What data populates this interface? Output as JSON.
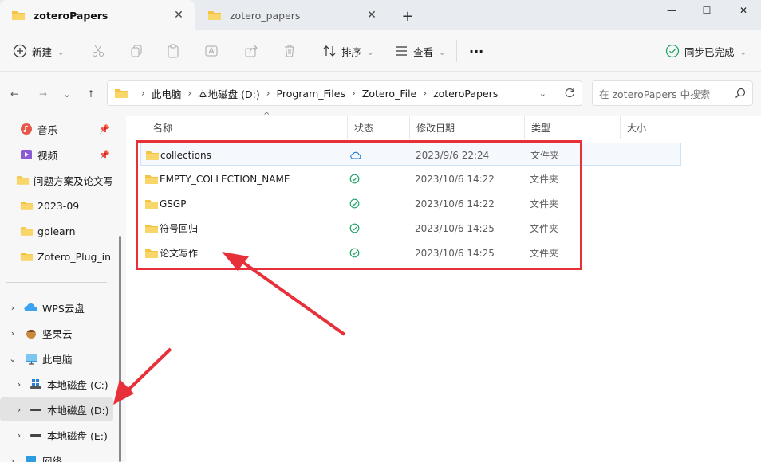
{
  "tabs": [
    {
      "title": "zoteroPapers",
      "close": "✕"
    },
    {
      "title": "zotero_papers",
      "close": "✕"
    }
  ],
  "new_tab": "+",
  "window": {
    "minimize": "—",
    "maximize": "☐",
    "close": "✕"
  },
  "toolbar": {
    "new_label": "新建",
    "new_arrow": "⌄",
    "sort_label": "排序",
    "sort_arrow": "⌄",
    "view_label": "查看",
    "view_arrow": "⌄",
    "more": "···",
    "sync_label": "同步已完成",
    "sync_arrow": "⌄"
  },
  "nav": {
    "back": "←",
    "forward": "→",
    "recent": "⌄",
    "up": "↑"
  },
  "breadcrumb": [
    "此电脑",
    "本地磁盘 (D:)",
    "Program_Files",
    "Zotero_File",
    "zoteroPapers"
  ],
  "search": {
    "placeholder": "在 zoteroPapers 中搜索"
  },
  "sidebar": {
    "quick": [
      {
        "label": "音乐",
        "pin": "📌",
        "icon": "music-icon"
      },
      {
        "label": "视频",
        "pin": "📌",
        "icon": "video-icon"
      },
      {
        "label": "问题方案及论文写",
        "icon": "folder-icon"
      },
      {
        "label": "2023-09",
        "icon": "folder-icon"
      },
      {
        "label": "gplearn",
        "icon": "folder-icon"
      },
      {
        "label": "Zotero_Plug_in",
        "icon": "folder-icon"
      }
    ],
    "tree": [
      {
        "label": "WPS云盘",
        "expander": "›",
        "icon": "cloud-icon"
      },
      {
        "label": "坚果云",
        "expander": "›",
        "icon": "nut-icon"
      },
      {
        "label": "此电脑",
        "expander": "⌄",
        "icon": "pc-icon"
      },
      {
        "label": "本地磁盘 (C:)",
        "expander": "›",
        "icon": "drive-icon"
      },
      {
        "label": "本地磁盘 (D:)",
        "expander": "›",
        "icon": "drive-icon",
        "selected": true
      },
      {
        "label": "本地磁盘 (E:)",
        "expander": "›",
        "icon": "drive-icon"
      },
      {
        "label": "网络",
        "expander": "›",
        "icon": "network-icon"
      }
    ]
  },
  "columns": {
    "name": "名称",
    "status": "状态",
    "modified": "修改日期",
    "type": "类型",
    "size": "大小"
  },
  "files": [
    {
      "name": "collections",
      "status": "cloud",
      "modified": "2023/9/6 22:24",
      "type": "文件夹"
    },
    {
      "name": "EMPTY_COLLECTION_NAME",
      "status": "synced",
      "modified": "2023/10/6 14:22",
      "type": "文件夹"
    },
    {
      "name": "GSGP",
      "status": "synced",
      "modified": "2023/10/6 14:22",
      "type": "文件夹"
    },
    {
      "name": "符号回归",
      "status": "synced",
      "modified": "2023/10/6 14:25",
      "type": "文件夹"
    },
    {
      "name": "论文写作",
      "status": "synced",
      "modified": "2023/10/6 14:25",
      "type": "文件夹"
    }
  ],
  "colors": {
    "annotation_red": "#e8303a",
    "folder_yellow": "#f4c343",
    "sync_green": "#21a366",
    "cloud_blue": "#1e7ad6"
  }
}
